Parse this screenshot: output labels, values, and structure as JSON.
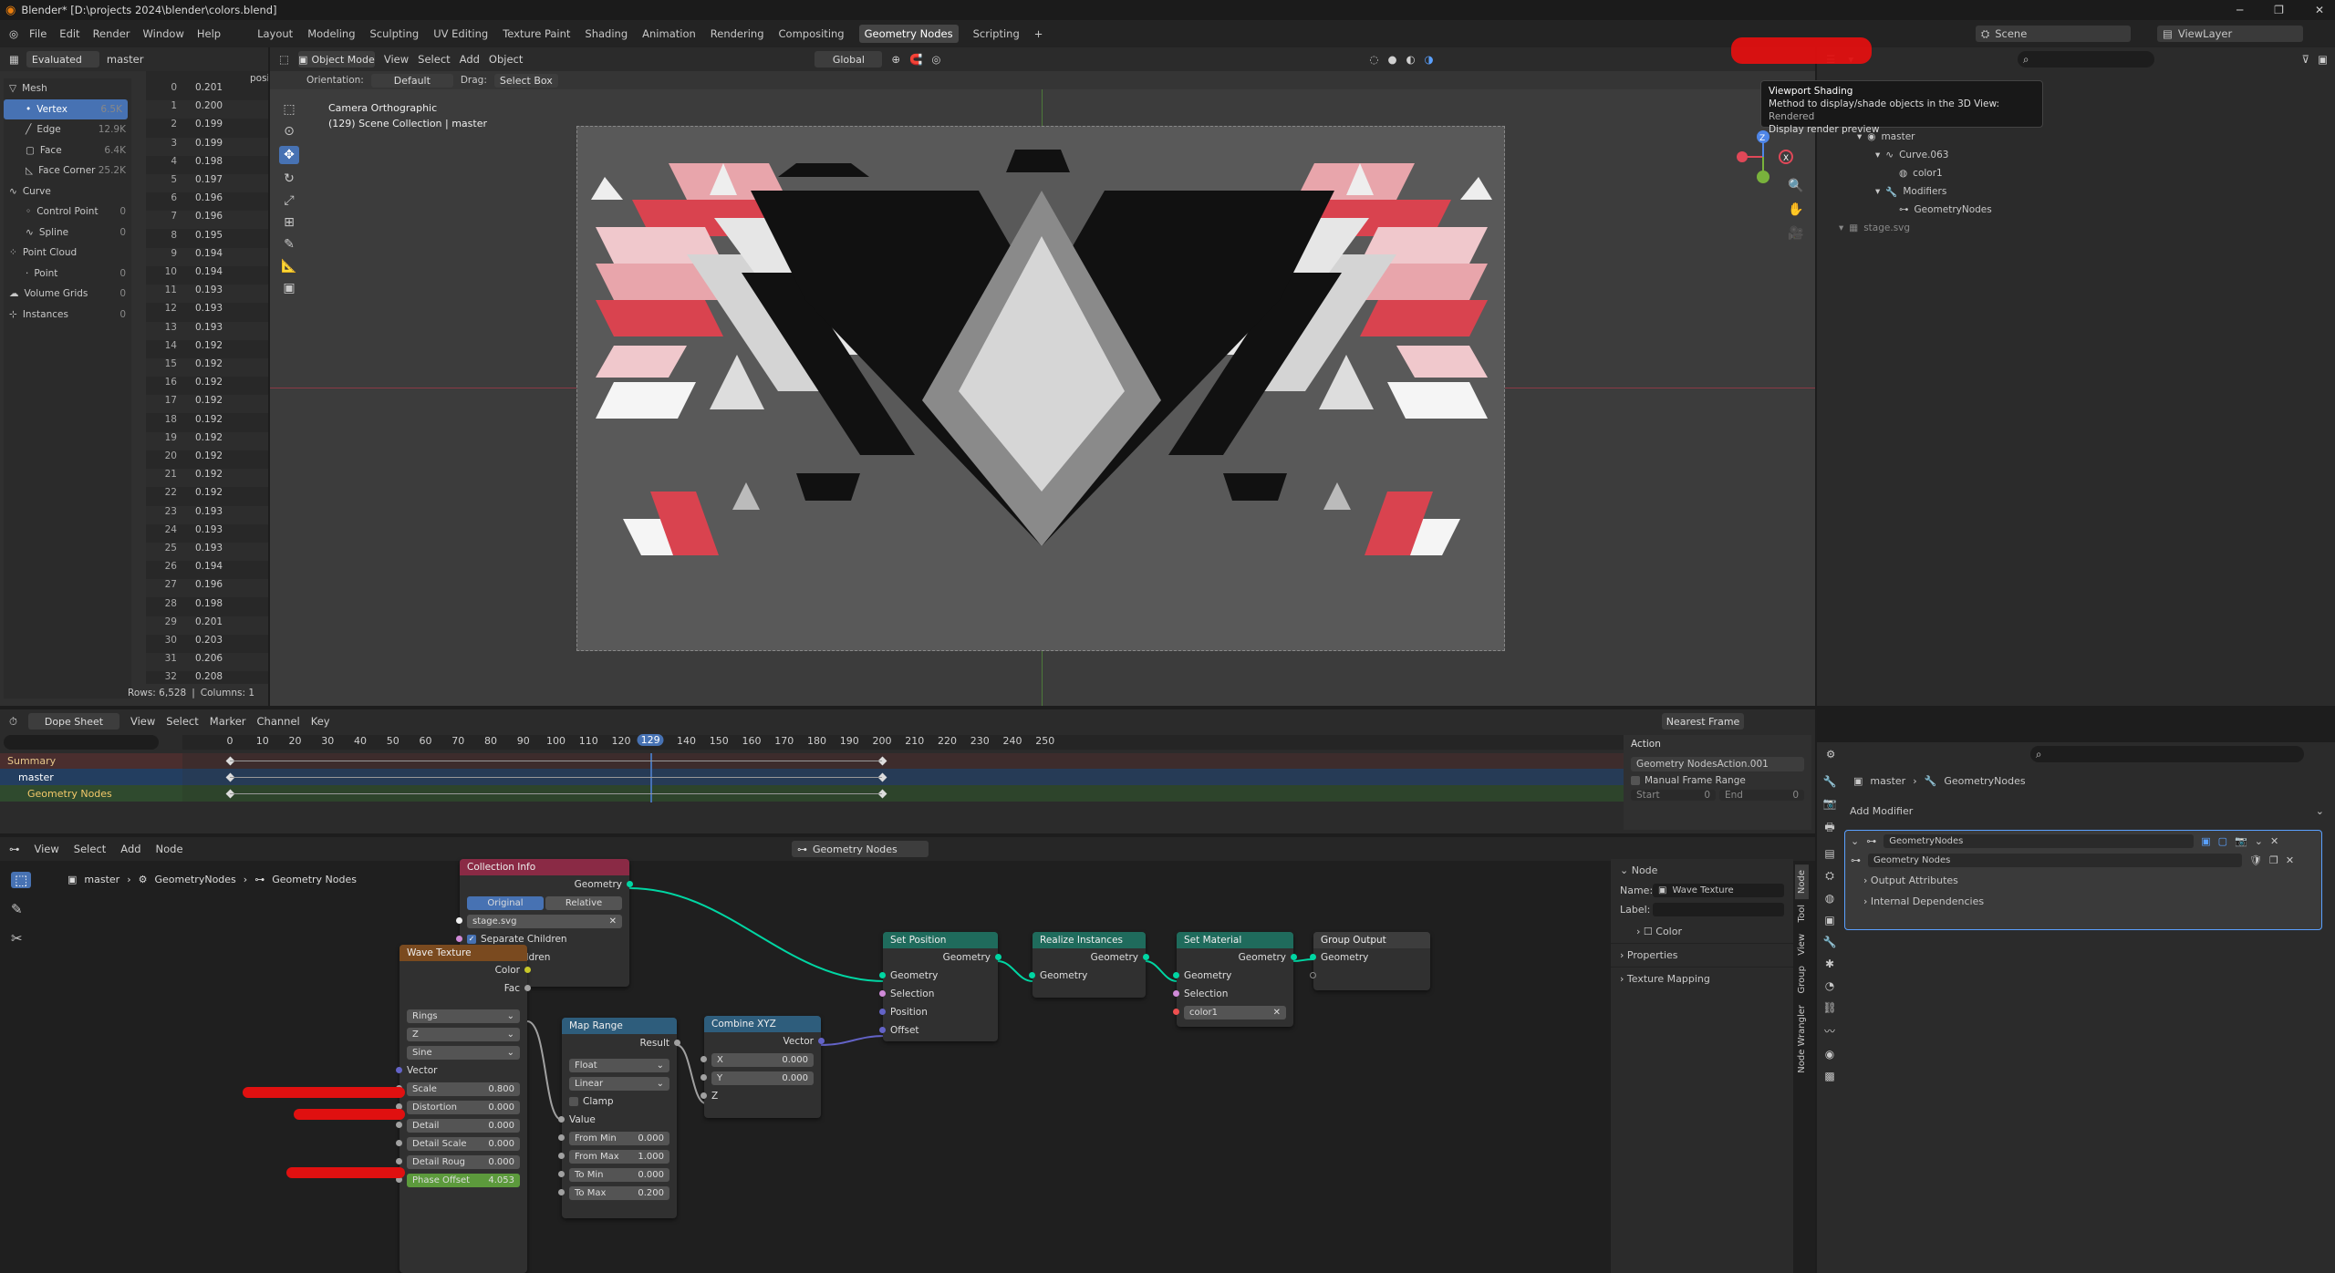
{
  "window": {
    "title": "Blender* [D:\\projects 2024\\blender\\colors.blend]",
    "controls": [
      "─",
      "❐",
      "✕"
    ]
  },
  "menu": [
    "File",
    "Edit",
    "Render",
    "Window",
    "Help"
  ],
  "workspaces": [
    "Layout",
    "Modeling",
    "Sculpting",
    "UV Editing",
    "Texture Paint",
    "Shading",
    "Animation",
    "Rendering",
    "Compositing",
    "Geometry Nodes",
    "Scripting"
  ],
  "active_workspace": "Geometry Nodes",
  "scene": {
    "name": "Scene",
    "view_layer": "ViewLayer"
  },
  "spreadsheet": {
    "eval_mode": "Evaluated",
    "object": "master",
    "col_header": "posi",
    "tree": [
      {
        "label": "Mesh",
        "count": ""
      },
      {
        "label": "Vertex",
        "count": "6.5K",
        "active": true
      },
      {
        "label": "Edge",
        "count": "12.9K"
      },
      {
        "label": "Face",
        "count": "6.4K"
      },
      {
        "label": "Face Corner",
        "count": "25.2K"
      },
      {
        "label": "Curve",
        "count": ""
      },
      {
        "label": "Control Point",
        "count": "0"
      },
      {
        "label": "Spline",
        "count": "0"
      },
      {
        "label": "Point Cloud",
        "count": ""
      },
      {
        "label": "Point",
        "count": "0"
      },
      {
        "label": "Volume Grids",
        "count": "0"
      },
      {
        "label": "Instances",
        "count": "0"
      }
    ],
    "rows": [
      [
        "0",
        "0.201"
      ],
      [
        "1",
        "0.200"
      ],
      [
        "2",
        "0.199"
      ],
      [
        "3",
        "0.199"
      ],
      [
        "4",
        "0.198"
      ],
      [
        "5",
        "0.197"
      ],
      [
        "6",
        "0.196"
      ],
      [
        "7",
        "0.196"
      ],
      [
        "8",
        "0.195"
      ],
      [
        "9",
        "0.194"
      ],
      [
        "10",
        "0.194"
      ],
      [
        "11",
        "0.193"
      ],
      [
        "12",
        "0.193"
      ],
      [
        "13",
        "0.193"
      ],
      [
        "14",
        "0.192"
      ],
      [
        "15",
        "0.192"
      ],
      [
        "16",
        "0.192"
      ],
      [
        "17",
        "0.192"
      ],
      [
        "18",
        "0.192"
      ],
      [
        "19",
        "0.192"
      ],
      [
        "20",
        "0.192"
      ],
      [
        "21",
        "0.192"
      ],
      [
        "22",
        "0.192"
      ],
      [
        "23",
        "0.193"
      ],
      [
        "24",
        "0.193"
      ],
      [
        "25",
        "0.193"
      ],
      [
        "26",
        "0.194"
      ],
      [
        "27",
        "0.196"
      ],
      [
        "28",
        "0.198"
      ],
      [
        "29",
        "0.201"
      ],
      [
        "30",
        "0.203"
      ],
      [
        "31",
        "0.206"
      ],
      [
        "32",
        "0.208"
      ]
    ],
    "footer": {
      "rows": "Rows: 6,528",
      "columns": "Columns: 1"
    }
  },
  "viewport": {
    "mode": "Object Mode",
    "menus": [
      "View",
      "Select",
      "Add",
      "Object"
    ],
    "orientation_label": "Orientation:",
    "orientation": "Default",
    "drag_label": "Drag:",
    "drag": "Select Box",
    "transform": "Global",
    "overlay_title": "Camera Orthographic",
    "overlay_sub": "(129) Scene Collection | master",
    "tooltip": {
      "title": "Viewport Shading",
      "desc": "Method to display/shade objects in the 3D View:",
      "value": "Rendered",
      "extra": "Display render preview"
    },
    "accent": "#d9434f"
  },
  "outliner": {
    "items": [
      {
        "label": "master",
        "depth": 1
      },
      {
        "label": "Curve.063",
        "depth": 2
      },
      {
        "label": "color1",
        "depth": 3
      },
      {
        "label": "Modifiers",
        "depth": 2
      },
      {
        "label": "GeometryNodes",
        "depth": 3
      },
      {
        "label": "stage.svg",
        "depth": 0
      }
    ]
  },
  "dopesheet": {
    "mode": "Dope Sheet",
    "menus": [
      "View",
      "Select",
      "Marker",
      "Channel",
      "Key"
    ],
    "snap": "Nearest Frame",
    "ticks": [
      "0",
      "10",
      "20",
      "30",
      "40",
      "50",
      "60",
      "70",
      "80",
      "90",
      "100",
      "110",
      "120",
      "129",
      "140",
      "150",
      "160",
      "170",
      "180",
      "190",
      "200",
      "210",
      "220",
      "230",
      "240",
      "250"
    ],
    "current_frame": 129,
    "channels": [
      "Summary",
      "master",
      "Geometry Nodes"
    ],
    "action": {
      "title": "Action",
      "name": "Geometry NodesAction.001",
      "manual": "Manual Frame Range",
      "start_label": "Start",
      "start": "0",
      "end_label": "End",
      "end": "0"
    }
  },
  "node_editor": {
    "menus": [
      "View",
      "Select",
      "Add",
      "Node"
    ],
    "tree_name": "Geometry Nodes",
    "breadcrumb": [
      "master",
      "GeometryNodes",
      "Geometry Nodes"
    ],
    "collection_info": {
      "title": "Collection Info",
      "out": "Geometry",
      "tab1": "Original",
      "tab2": "Relative",
      "collection": "stage.svg",
      "sep": "Separate Children",
      "reset": "Reset Children"
    },
    "wave": {
      "title": "Wave Texture",
      "color": "Color",
      "fac": "Fac",
      "type": "Rings",
      "dir": "Z",
      "profile": "Sine",
      "vector": "Vector",
      "fields": [
        [
          "Scale",
          "0.800"
        ],
        [
          "Distortion",
          "0.000"
        ],
        [
          "Detail",
          "0.000"
        ],
        [
          "Detail Scale",
          "0.000"
        ],
        [
          "Detail Roug",
          "0.000"
        ],
        [
          "Phase Offset",
          "4.053"
        ]
      ]
    },
    "map_range": {
      "title": "Map Range",
      "result": "Result",
      "dtype": "Float",
      "interp": "Linear",
      "clamp": "Clamp",
      "value": "Value",
      "fields": [
        [
          "From Min",
          "0.000"
        ],
        [
          "From Max",
          "1.000"
        ],
        [
          "To Min",
          "0.000"
        ],
        [
          "To Max",
          "0.200"
        ]
      ]
    },
    "combine": {
      "title": "Combine XYZ",
      "vector": "Vector",
      "x": "X",
      "xv": "0.000",
      "y": "Y",
      "yv": "0.000",
      "z": "Z"
    },
    "set_position": {
      "title": "Set Position",
      "geo": "Geometry",
      "sel": "Selection",
      "pos": "Position",
      "off": "Offset"
    },
    "realize": {
      "title": "Realize Instances",
      "geo": "Geometry"
    },
    "set_material": {
      "title": "Set Material",
      "geo": "Geometry",
      "sel": "Selection",
      "mat": "color1"
    },
    "group_output": {
      "title": "Group Output",
      "geo": "Geometry"
    },
    "sidebar": {
      "node": "Node",
      "name_label": "Name:",
      "name": "Wave Texture",
      "label_label": "Label:",
      "color": "Color",
      "properties": "Properties",
      "mapping": "Texture Mapping",
      "tabs": [
        "Node",
        "Tool",
        "View",
        "Group",
        "Node Wrangler"
      ]
    }
  },
  "properties": {
    "breadcrumb": [
      "master",
      "GeometryNodes"
    ],
    "add_modifier": "Add Modifier",
    "modifier": "GeometryNodes",
    "group": "Geometry Nodes",
    "output_attrs": "Output Attributes",
    "internal": "Internal Dependencies"
  }
}
